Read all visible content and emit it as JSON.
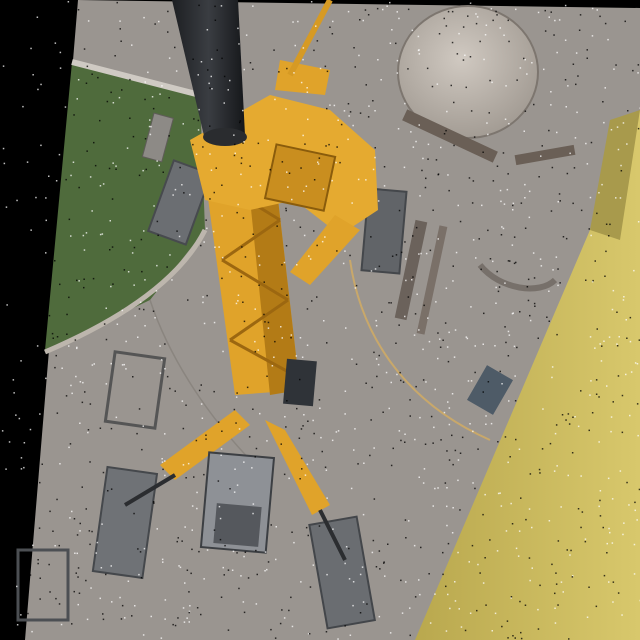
{
  "image": {
    "subject": "aerial-view-crawler-crane",
    "colors": {
      "frame": "#000000",
      "pavement": "#9a9590",
      "pavement_dark": "#86817c",
      "grass": "#4f6b3c",
      "crane_yellow": "#e0a32a",
      "crane_shadow": "#b37b16",
      "tank": "#b8b1aa",
      "wall_yellow": "#cdbb5d",
      "steel": "#5a5f66"
    }
  }
}
